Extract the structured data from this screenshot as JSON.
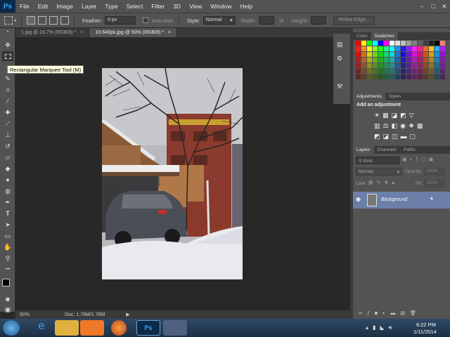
{
  "menubar": {
    "logo": "Ps",
    "items": [
      "File",
      "Edit",
      "Image",
      "Layer",
      "Type",
      "Select",
      "Filter",
      "3D",
      "View",
      "Window",
      "Help"
    ],
    "window_controls": [
      "–",
      "□",
      "✕"
    ]
  },
  "options": {
    "feather_label": "Feather:",
    "feather_value": "0 px",
    "antialias_label": "Anti-alias",
    "style_label": "Style:",
    "style_value": "Normal",
    "width_label": "Width:",
    "height_label": "Height:",
    "refine_edge": "Refine Edge..."
  },
  "tabs": [
    {
      "label": "1.jpg @ 16.7% (RGB/8) *",
      "close": "×",
      "active": false
    },
    {
      "label": "10-640px.jpg @ 50% (RGB/8) *",
      "close": "×",
      "active": true
    }
  ],
  "tooltip": "Rectangular Marquee Tool (M)",
  "status": {
    "zoom": "50%",
    "doc": "Doc: 1.76M/1.76M"
  },
  "color_panel": {
    "tabs": [
      "Color",
      "Swatches"
    ],
    "active": "Swatches"
  },
  "adjustments_panel": {
    "tabs": [
      "Adjustments",
      "Styles"
    ],
    "heading": "Add an adjustment"
  },
  "layers_panel": {
    "tabs": [
      "Layers",
      "Channels",
      "Paths"
    ],
    "kind_label": "Kind",
    "blend_mode": "Normal",
    "opacity_label": "Opacity:",
    "opacity_value": "100%",
    "lock_label": "Lock:",
    "fill_label": "Fill:",
    "fill_value": "100%",
    "layer_name": "Background"
  },
  "taskbar": {
    "time": "6:22 PM",
    "date": "1/11/2014"
  },
  "colors": {
    "ui_gray": "#535353",
    "dark_gray": "#3a3a3a",
    "canvas_bg": "#282828",
    "selected_layer": "#6b7fa8",
    "ps_blue": "#31a8ff"
  }
}
